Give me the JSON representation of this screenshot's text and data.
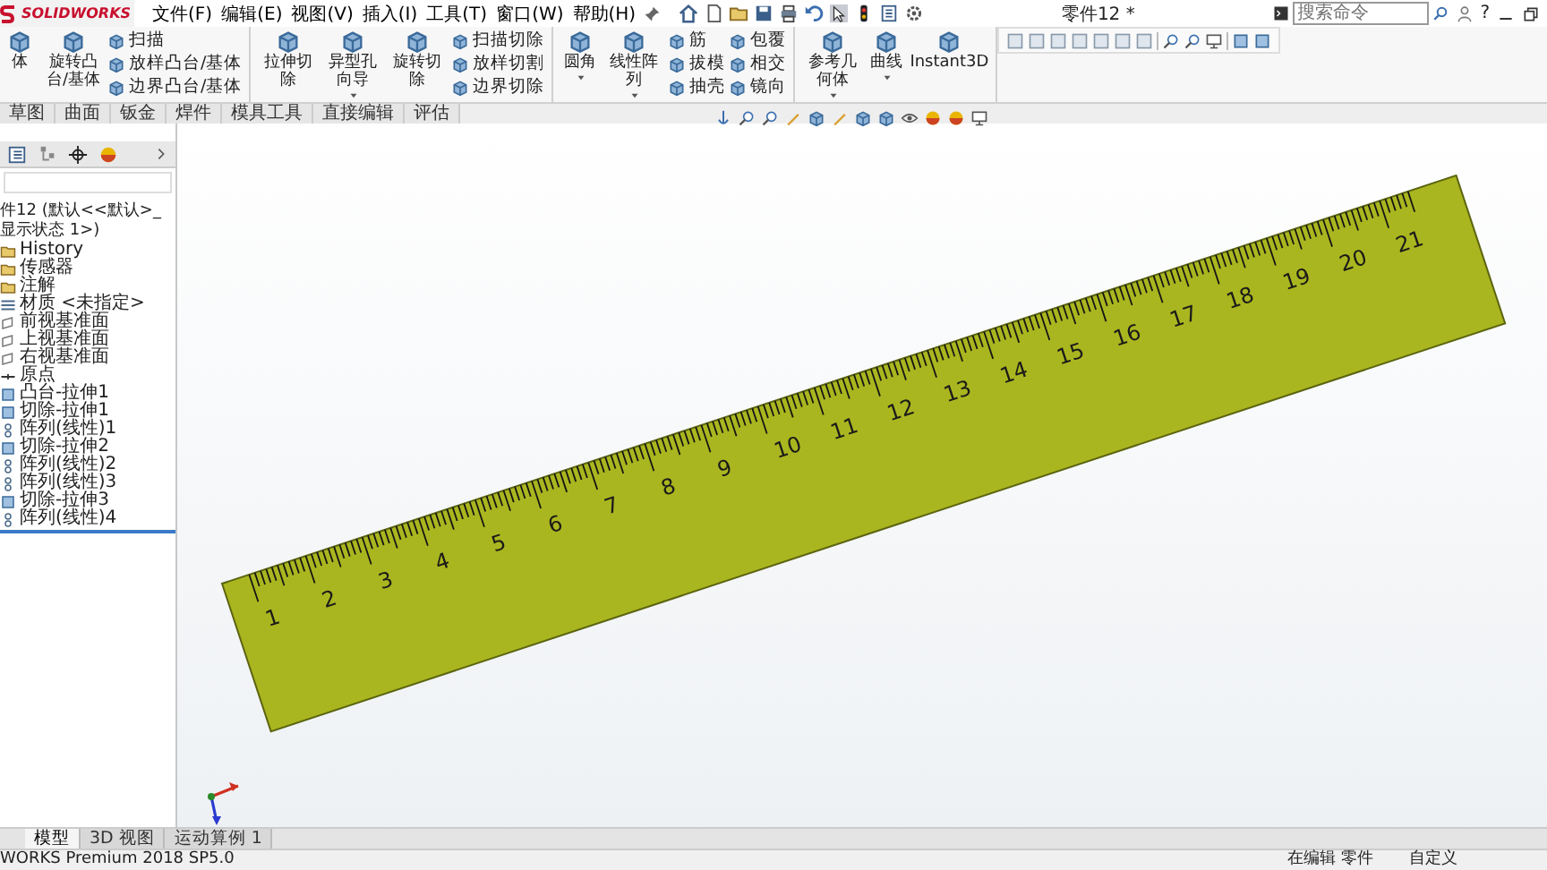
{
  "app": {
    "logo": "SOLIDWORKS",
    "menu": [
      "文件(F)",
      "编辑(E)",
      "视图(V)",
      "插入(I)",
      "工具(T)",
      "窗口(W)",
      "帮助(H)"
    ],
    "title": "零件12 *",
    "search": {
      "placeholder": "搜索命令"
    },
    "help": "?"
  },
  "ribbon": {
    "groups": [
      {
        "large": [
          {
            "label": "体",
            "dropdown": false
          },
          {
            "label": "旋转凸台/基体",
            "dropdown": false
          }
        ],
        "small": [
          [
            "扫描",
            "放样凸台/基体",
            "边界凸台/基体"
          ]
        ]
      },
      {
        "large": [
          {
            "label": "拉伸切除",
            "dropdown": false
          },
          {
            "label": "异型孔向导",
            "dropdown": true
          },
          {
            "label": "旋转切除",
            "dropdown": false
          }
        ],
        "small": [
          [
            "扫描切除",
            "放样切割",
            "边界切除"
          ]
        ]
      },
      {
        "large": [
          {
            "label": "圆角",
            "dropdown": true
          },
          {
            "label": "线性阵列",
            "dropdown": true
          }
        ],
        "small": [
          [
            "筋",
            "拔模",
            "抽壳"
          ],
          [
            "包覆",
            "相交",
            "镜向"
          ]
        ]
      },
      {
        "large": [
          {
            "label": "参考几何体",
            "dropdown": true
          },
          {
            "label": "曲线",
            "dropdown": true
          },
          {
            "label": "Instant3D",
            "dropdown": false
          }
        ]
      }
    ],
    "tabs": [
      {
        "label": "草图",
        "selected": false
      },
      {
        "label": "曲面",
        "selected": false
      },
      {
        "label": "钣金",
        "selected": false
      },
      {
        "label": "焊件",
        "selected": false
      },
      {
        "label": "模具工具",
        "selected": false
      },
      {
        "label": "直接编辑",
        "selected": false
      },
      {
        "label": "评估",
        "selected": false
      }
    ]
  },
  "tree": {
    "header": "件12 (默认<<默认>_显示状态 1>)",
    "items": [
      {
        "label": "History",
        "kind": "folder"
      },
      {
        "label": "传感器",
        "kind": "folder"
      },
      {
        "label": "注解",
        "kind": "folder"
      },
      {
        "label": "材质 <未指定>",
        "kind": "material"
      },
      {
        "label": "前视基准面",
        "kind": "plane"
      },
      {
        "label": "上视基准面",
        "kind": "plane"
      },
      {
        "label": "右视基准面",
        "kind": "plane"
      },
      {
        "label": "原点",
        "kind": "origin"
      },
      {
        "label": "凸台-拉伸1",
        "kind": "feature"
      },
      {
        "label": "切除-拉伸1",
        "kind": "feature"
      },
      {
        "label": "阵列(线性)1",
        "kind": "pattern"
      },
      {
        "label": "切除-拉伸2",
        "kind": "feature"
      },
      {
        "label": "阵列(线性)2",
        "kind": "pattern"
      },
      {
        "label": "阵列(线性)3",
        "kind": "pattern"
      },
      {
        "label": "切除-拉伸3",
        "kind": "feature"
      },
      {
        "label": "阵列(线性)4",
        "kind": "pattern"
      }
    ]
  },
  "ruler": {
    "labels": [
      "1",
      "2",
      "3",
      "4",
      "5",
      "6",
      "7",
      "8",
      "9",
      "10",
      "11",
      "12",
      "13",
      "14",
      "15",
      "16",
      "17",
      "18",
      "19",
      "20",
      "21"
    ]
  },
  "bottom_tabs": [
    {
      "label": "模型",
      "selected": true
    },
    {
      "label": "3D 视图",
      "selected": false
    },
    {
      "label": "运动算例 1",
      "selected": false
    }
  ],
  "status_bar": {
    "version": "WORKS Premium 2018 SP5.0",
    "mode": "在编辑 零件",
    "units": "自定义"
  }
}
